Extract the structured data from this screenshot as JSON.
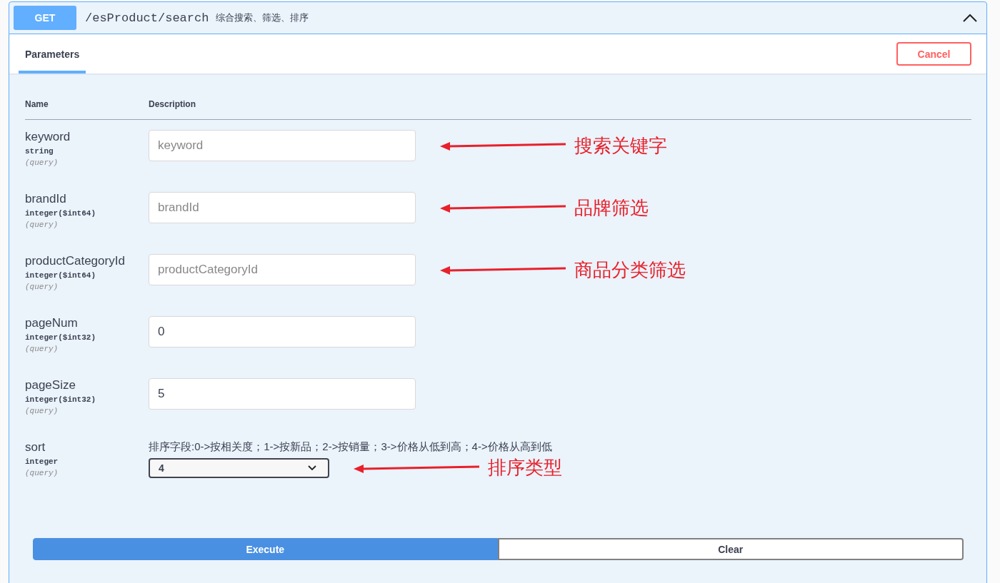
{
  "operation": {
    "method": "GET",
    "path": "/esProduct/search",
    "summary": "综合搜索、筛选、排序",
    "expanded": true
  },
  "tabs": [
    {
      "label": "Parameters",
      "selected": true
    }
  ],
  "cancel_button": "Cancel",
  "table": {
    "columns": [
      "Name",
      "Description"
    ]
  },
  "parameters": [
    {
      "name": "keyword",
      "type": "string",
      "location": "(query)",
      "kind": "input",
      "placeholder": "keyword",
      "annotation": "搜索关键字"
    },
    {
      "name": "brandId",
      "type": "integer($int64)",
      "location": "(query)",
      "kind": "input",
      "placeholder": "brandId",
      "annotation": "品牌筛选"
    },
    {
      "name": "productCategoryId",
      "type": "integer($int64)",
      "location": "(query)",
      "kind": "input",
      "placeholder": "productCategoryId",
      "annotation": "商品分类筛选"
    },
    {
      "name": "pageNum",
      "type": "integer($int32)",
      "location": "(query)",
      "kind": "input",
      "value": "0"
    },
    {
      "name": "pageSize",
      "type": "integer($int32)",
      "location": "(query)",
      "kind": "input",
      "value": "5"
    },
    {
      "name": "sort",
      "type": "integer",
      "location": "(query)",
      "kind": "select",
      "description": "排序字段:0->按相关度；1->按新品；2->按销量；3->价格从低到高；4->价格从高到低",
      "value": "4",
      "annotation": "排序类型"
    }
  ],
  "buttons": [
    "Execute",
    "Clear"
  ]
}
